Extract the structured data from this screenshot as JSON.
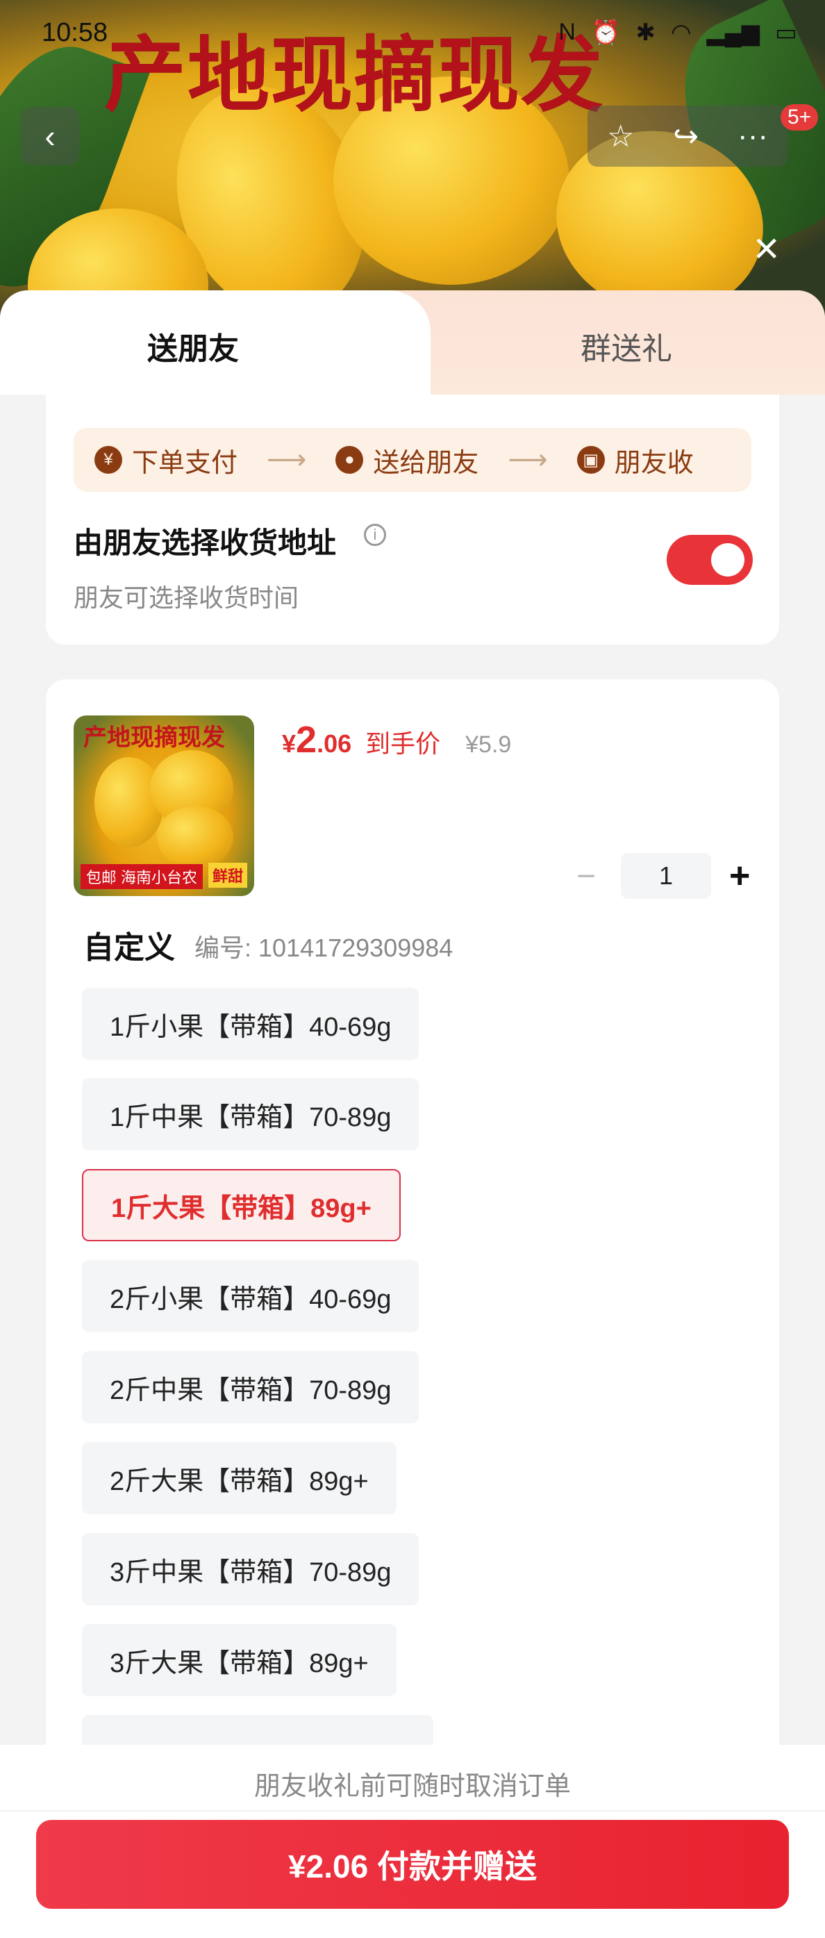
{
  "status_bar": {
    "time": "10:58",
    "icons": [
      "nfc-icon",
      "alarm-icon",
      "bluetooth-icon",
      "wifi-icon",
      "signal-icon",
      "battery-icon"
    ]
  },
  "hero": {
    "banner_text": "产地现摘现发"
  },
  "nav": {
    "back_icon": "back-arrow-icon",
    "favorite_icon": "star-icon",
    "share_icon": "share-icon",
    "more_icon": "more-icon",
    "badge": "5+"
  },
  "tabs": {
    "send_friend": "送朋友",
    "group_gift": "群送礼"
  },
  "steps": [
    {
      "icon_glyph": "¥",
      "label": "下单支付"
    },
    {
      "icon_glyph": "●",
      "label": "送给朋友"
    },
    {
      "icon_glyph": "▣",
      "label": "朋友收"
    }
  ],
  "address_option": {
    "title": "由朋友选择收货地址",
    "subtitle": "朋友可选择收货时间",
    "info_glyph": "i",
    "toggle_on": true
  },
  "product": {
    "thumb_title": "产地现摘现发",
    "thumb_tags": [
      "包邮",
      "海南小台农",
      "鲜甜"
    ],
    "price_symbol": "¥",
    "price_int": "2",
    "price_dec": ".06",
    "price_label": "到手价",
    "original_price": "¥5.9",
    "quantity": "1",
    "minus": "−",
    "plus": "+"
  },
  "spec": {
    "title": "自定义",
    "code": "编号: 10141729309984",
    "options": [
      {
        "label": "1斤小果【带箱】40-69g",
        "selected": false
      },
      {
        "label": "1斤中果【带箱】70-89g",
        "selected": false
      },
      {
        "label": "1斤大果【带箱】89g+",
        "selected": true
      },
      {
        "label": "2斤小果【带箱】40-69g",
        "selected": false
      },
      {
        "label": "2斤中果【带箱】70-89g",
        "selected": false
      },
      {
        "label": "2斤大果【带箱】89g+",
        "selected": false
      },
      {
        "label": "3斤中果【带箱】70-89g",
        "selected": false
      },
      {
        "label": "3斤大果【带箱】89g+",
        "selected": false
      }
    ]
  },
  "footer": {
    "note": "朋友收礼前可随时取消订单",
    "pay_button": "¥2.06 付款并赠送"
  },
  "colors": {
    "accent": "#e02d2d",
    "toggle": "#e83438",
    "step_text": "#8a3b12"
  }
}
